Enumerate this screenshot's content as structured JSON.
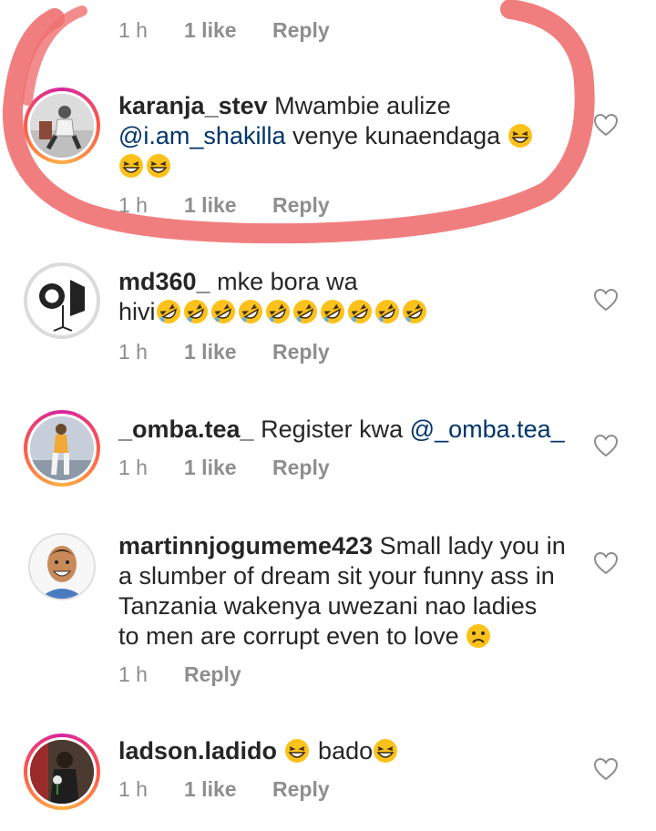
{
  "top_meta": {
    "time": "1 h",
    "likes": "1 like",
    "reply": "Reply"
  },
  "comments": [
    {
      "username": "karanja_stev",
      "text_before": "Mwambie aulize",
      "mention": "@i.am_shakilla",
      "text_after": "venye kunaendaga",
      "emojis": [
        "grinning-squint-emoji",
        "grinning-squint-emoji",
        "grinning-squint-emoji"
      ],
      "time": "1 h",
      "likes": "1 like",
      "reply": "Reply",
      "avatar": "man-sitting-photo"
    },
    {
      "username": "md360_",
      "text_line1": "mke bora wa",
      "text_line2": "hivi",
      "emojis": [
        "rofl-emoji",
        "rofl-emoji",
        "rofl-emoji",
        "rofl-emoji",
        "rofl-emoji",
        "rofl-emoji",
        "rofl-emoji",
        "rofl-emoji",
        "rofl-emoji",
        "rofl-emoji"
      ],
      "time": "1 h",
      "likes": "1 like",
      "reply": "Reply",
      "avatar": "studio-light-logo"
    },
    {
      "username": "_omba.tea_",
      "text_before": "Register kwa",
      "mention": "@_omba.tea_",
      "time": "1 h",
      "likes": "1 like",
      "reply": "Reply",
      "avatar": "person-standing-photo"
    },
    {
      "username": "martinnjogumeme423",
      "text_line1": "Small lady you in",
      "text_line2": "a slumber of dream sit your funny ass in",
      "text_line3": "Tanzania wakenya uwezani nao ladies",
      "text_line4": "to men are corrupt even to love",
      "emojis": [
        "sad-face-emoji"
      ],
      "time": "1 h",
      "reply": "Reply",
      "avatar": "cartoon-man-avatar"
    },
    {
      "username": "ladson.ladido",
      "text_mid": "bado",
      "emojis": [
        "grinning-squint-emoji",
        "grinning-squint-emoji"
      ],
      "time": "1 h",
      "likes": "1 like",
      "reply": "Reply",
      "avatar": "man-with-flower-photo"
    }
  ],
  "colors": {
    "username": "#262626",
    "meta": "#8e8e8e",
    "mention": "#003569",
    "annotation": "#f07070"
  }
}
